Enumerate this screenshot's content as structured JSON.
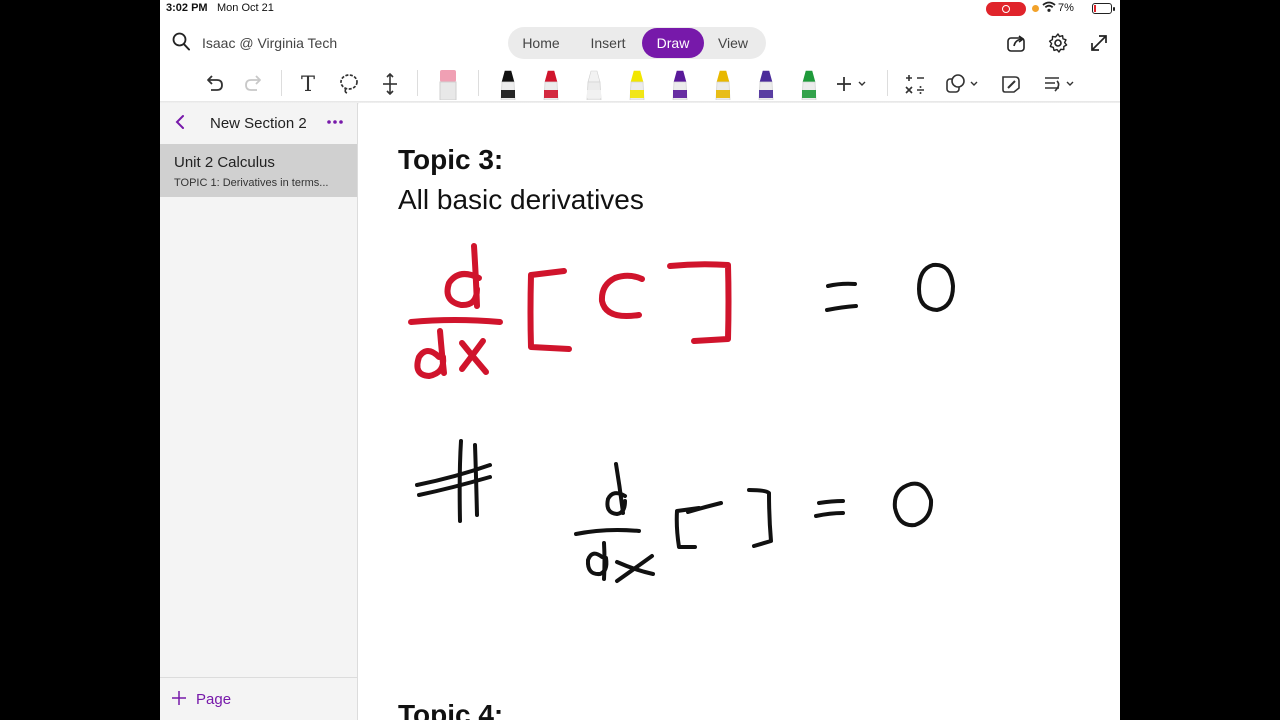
{
  "status_bar": {
    "time": "3:02 PM",
    "date": "Mon Oct 21",
    "battery": "7%"
  },
  "header": {
    "notebook": "Isaac @ Virginia Tech",
    "tabs": [
      {
        "label": "Home"
      },
      {
        "label": "Insert"
      },
      {
        "label": "Draw"
      },
      {
        "label": "View"
      }
    ],
    "active_tab": "Draw"
  },
  "pens": [
    {
      "name": "black-marker",
      "color": "#111111"
    },
    {
      "name": "red-pen",
      "color": "#d0142c"
    },
    {
      "name": "white-pen",
      "color": "#f2f2f2"
    },
    {
      "name": "yellow-highlighter",
      "color": "#f2e600"
    },
    {
      "name": "purple-pen",
      "color": "#5a1a9a"
    },
    {
      "name": "gold-pen",
      "color": "#e8b800"
    },
    {
      "name": "violet-pen",
      "color": "#4a2b9a"
    },
    {
      "name": "green-pen",
      "color": "#1f9a3a"
    }
  ],
  "sidebar": {
    "section_title": "New Section 2",
    "pages": [
      {
        "title": "Unit 2 Calculus",
        "subtitle": "TOPIC 1:  Derivatives in terms..."
      }
    ],
    "add_page_label": "Page"
  },
  "canvas": {
    "topic3_heading": "Topic 3:",
    "topic3_body": "All basic derivatives",
    "topic4_heading": "Topic 4:",
    "ink_colors": {
      "red": "#d0142c",
      "black": "#111111"
    }
  },
  "colors": {
    "accent": "#7719aa"
  }
}
